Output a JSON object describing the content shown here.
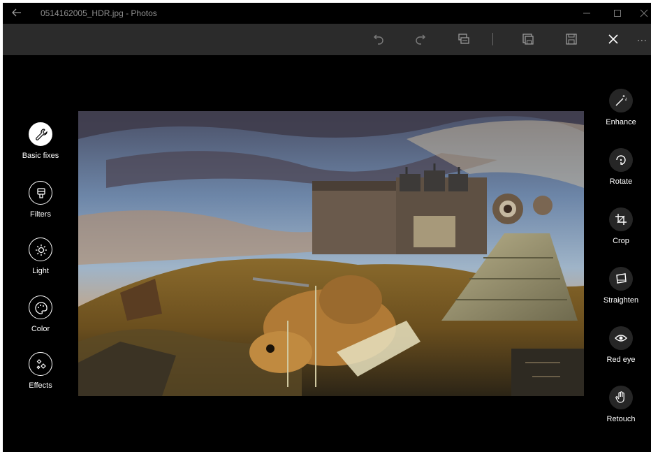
{
  "window": {
    "title": "0514162005_HDR.jpg - Photos"
  },
  "toolbar": {
    "buttons": [
      "undo-icon",
      "redo-icon",
      "compare-icon",
      "save-copy-icon",
      "save-icon",
      "close-icon",
      "more-icon"
    ],
    "more_label": "..."
  },
  "left_tools": [
    {
      "label": "Basic fixes",
      "icon": "wrench-icon",
      "active": true
    },
    {
      "label": "Filters",
      "icon": "filter-icon",
      "active": false
    },
    {
      "label": "Light",
      "icon": "sun-icon",
      "active": false
    },
    {
      "label": "Color",
      "icon": "palette-icon",
      "active": false
    },
    {
      "label": "Effects",
      "icon": "effects-icon",
      "active": false
    }
  ],
  "right_tools": [
    {
      "label": "Enhance",
      "icon": "magic-wand-icon"
    },
    {
      "label": "Rotate",
      "icon": "rotate-icon"
    },
    {
      "label": "Crop",
      "icon": "crop-icon"
    },
    {
      "label": "Straighten",
      "icon": "straighten-icon"
    },
    {
      "label": "Red eye",
      "icon": "eye-icon"
    },
    {
      "label": "Retouch",
      "icon": "hand-icon"
    }
  ],
  "colors": {
    "window_bg": "#000000",
    "toolbar_bg": "#2b2b2b",
    "tool_circle_bg": "#262626",
    "text": "#ffffff"
  }
}
